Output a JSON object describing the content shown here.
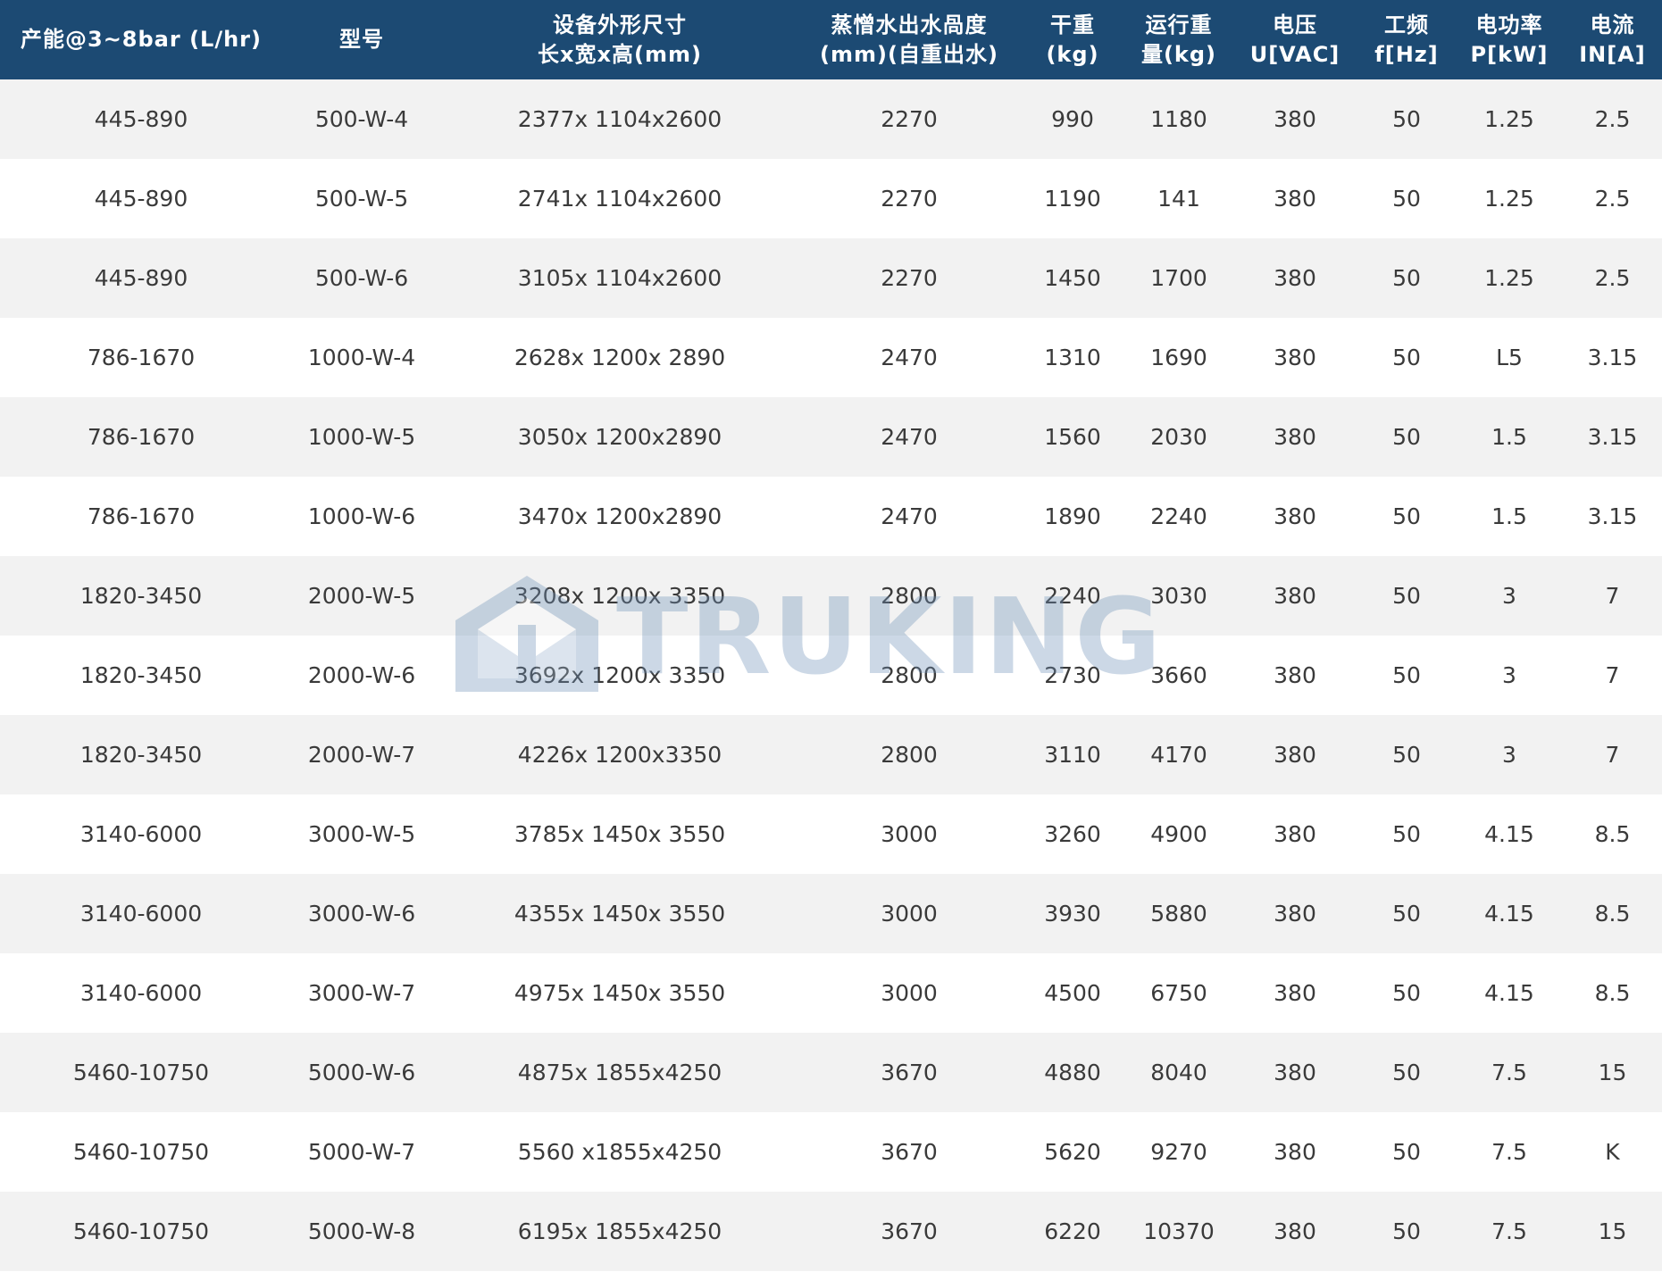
{
  "colors": {
    "header_bg": "#1c4a73",
    "header_text": "#ffffff",
    "row_odd": "#f2f2f2",
    "row_even": "#ffffff",
    "cell_text": "#3a3a3a",
    "watermark": "#6f92b8"
  },
  "watermark": {
    "text": "TRUKING",
    "icon": "truking-logo-icon"
  },
  "table": {
    "headers": [
      [
        "产能@3~8bar (L/hr)"
      ],
      [
        "型号"
      ],
      [
        "设备外形尺寸",
        "长x宽x高(mm)"
      ],
      [
        "蒸憎水出水咼度",
        "(mm)(自重出水)"
      ],
      [
        "干重",
        "(kg)"
      ],
      [
        "运行重",
        "量(kg)"
      ],
      [
        "电压",
        "U[VAC]"
      ],
      [
        "工频",
        "f[Hz]"
      ],
      [
        "电功率",
        "P[kW]"
      ],
      [
        "电流",
        "IN[A]"
      ]
    ],
    "rows": [
      [
        "445-890",
        "500-W-4",
        "2377x 1104x2600",
        "2270",
        "990",
        "1180",
        "380",
        "50",
        "1.25",
        "2.5"
      ],
      [
        "445-890",
        "500-W-5",
        "2741x 1104x2600",
        "2270",
        "1190",
        "141",
        "380",
        "50",
        "1.25",
        "2.5"
      ],
      [
        "445-890",
        "500-W-6",
        "3105x 1104x2600",
        "2270",
        "1450",
        "1700",
        "380",
        "50",
        "1.25",
        "2.5"
      ],
      [
        "786-1670",
        "1000-W-4",
        "2628x 1200x 2890",
        "2470",
        "1310",
        "1690",
        "380",
        "50",
        "L5",
        "3.15"
      ],
      [
        "786-1670",
        "1000-W-5",
        "3050x 1200x2890",
        "2470",
        "1560",
        "2030",
        "380",
        "50",
        "1.5",
        "3.15"
      ],
      [
        "786-1670",
        "1000-W-6",
        "3470x 1200x2890",
        "2470",
        "1890",
        "2240",
        "380",
        "50",
        "1.5",
        "3.15"
      ],
      [
        "1820-3450",
        "2000-W-5",
        "3208x 1200x 3350",
        "2800",
        "2240",
        "3030",
        "380",
        "50",
        "3",
        "7"
      ],
      [
        "1820-3450",
        "2000-W-6",
        "3692x 1200x 3350",
        "2800",
        "2730",
        "3660",
        "380",
        "50",
        "3",
        "7"
      ],
      [
        "1820-3450",
        "2000-W-7",
        "4226x 1200x3350",
        "2800",
        "3110",
        "4170",
        "380",
        "50",
        "3",
        "7"
      ],
      [
        "3140-6000",
        "3000-W-5",
        "3785x 1450x 3550",
        "3000",
        "3260",
        "4900",
        "380",
        "50",
        "4.15",
        "8.5"
      ],
      [
        "3140-6000",
        "3000-W-6",
        "4355x 1450x 3550",
        "3000",
        "3930",
        "5880",
        "380",
        "50",
        "4.15",
        "8.5"
      ],
      [
        "3140-6000",
        "3000-W-7",
        "4975x 1450x 3550",
        "3000",
        "4500",
        "6750",
        "380",
        "50",
        "4.15",
        "8.5"
      ],
      [
        "5460-10750",
        "5000-W-6",
        "4875x 1855x4250",
        "3670",
        "4880",
        "8040",
        "380",
        "50",
        "7.5",
        "15"
      ],
      [
        "5460-10750",
        "5000-W-7",
        "5560 x1855x4250",
        "3670",
        "5620",
        "9270",
        "380",
        "50",
        "7.5",
        "K"
      ],
      [
        "5460-10750",
        "5000-W-8",
        "6195x 1855x4250",
        "3670",
        "6220",
        "10370",
        "380",
        "50",
        "7.5",
        "15"
      ]
    ]
  }
}
